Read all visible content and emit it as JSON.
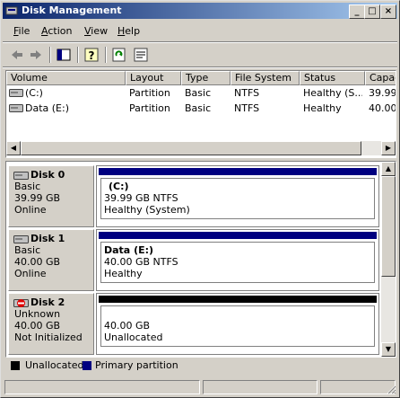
{
  "window": {
    "title": "Disk Management"
  },
  "menu": [
    {
      "label": "File",
      "key": "F",
      "rest": "ile"
    },
    {
      "label": "Action",
      "key": "A",
      "rest": "ction"
    },
    {
      "label": "View",
      "key": "V",
      "rest": "iew"
    },
    {
      "label": "Help",
      "key": "H",
      "rest": "elp"
    }
  ],
  "toolbar_icons": [
    "back-icon",
    "forward-icon",
    "console-tree-icon",
    "help-icon",
    "refresh-icon",
    "properties-icon"
  ],
  "volume_table": {
    "columns": [
      "Volume",
      "Layout",
      "Type",
      "File System",
      "Status",
      "Capac"
    ],
    "rows": [
      {
        "volume": "(C:)",
        "layout": "Partition",
        "type": "Basic",
        "fs": "NTFS",
        "status": "Healthy (S...",
        "capacity": "39.99"
      },
      {
        "volume": "Data (E:)",
        "layout": "Partition",
        "type": "Basic",
        "fs": "NTFS",
        "status": "Healthy",
        "capacity": "40.00"
      }
    ]
  },
  "disks": [
    {
      "name": "Disk 0",
      "kind": "Basic",
      "size": "39.99 GB",
      "state": "Online",
      "stripe_color": "#000080",
      "partition": {
        "title": "(C:)",
        "detail": "39.99 GB NTFS",
        "status": "Healthy (System)"
      }
    },
    {
      "name": "Disk 1",
      "kind": "Basic",
      "size": "40.00 GB",
      "state": "Online",
      "stripe_color": "#000080",
      "partition": {
        "title": "Data  (E:)",
        "detail": "40.00 GB NTFS",
        "status": "Healthy"
      }
    },
    {
      "name": "Disk 2",
      "kind": "Unknown",
      "size": "40.00 GB",
      "state": "Not Initialized",
      "stripe_color": "#000000",
      "partition": {
        "title": "",
        "detail": "40.00 GB",
        "status": "Unallocated"
      }
    }
  ],
  "legend": [
    {
      "label": "Unallocated",
      "color": "#000000"
    },
    {
      "label": "Primary partition",
      "color": "#000080"
    }
  ],
  "colors": {
    "titlebar_start": "#0a246a",
    "titlebar_end": "#a6caf0",
    "face": "#d4d0c8"
  }
}
